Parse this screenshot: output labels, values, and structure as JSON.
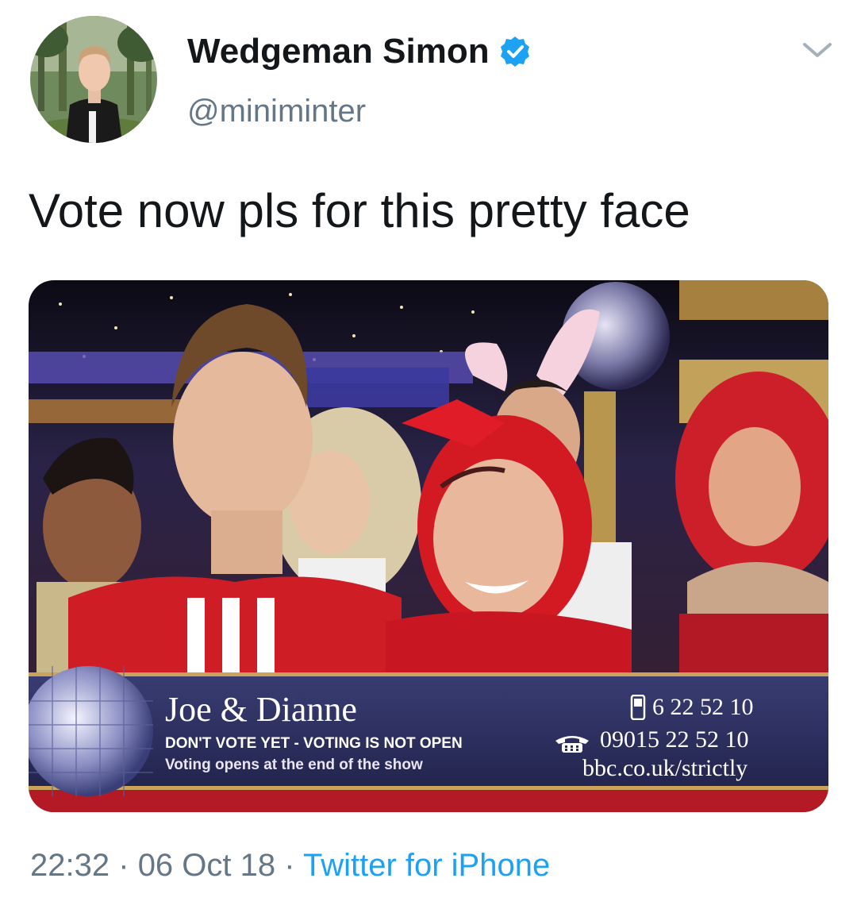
{
  "author": {
    "display_name": "Wedgeman Simon",
    "handle": "@miniminter",
    "verified": true,
    "avatar_icon": "profile-photo",
    "verified_icon": "verified-badge-icon"
  },
  "menu": {
    "icon": "chevron-down-icon"
  },
  "tweet": {
    "text": "Vote now pls for this pretty face"
  },
  "media": {
    "lower_third": {
      "couple": "Joe & Dianne",
      "warning": "DON'T VOTE YET - VOTING IS NOT OPEN",
      "opens": "Voting opens at the end of the show",
      "mobile_number": "6 22 52 10",
      "landline_number": "09015 22 52 10",
      "url": "bbc.co.uk/strictly"
    }
  },
  "meta": {
    "time": "22:32",
    "separator": "·",
    "date": "06 Oct 18",
    "source": "Twitter for iPhone"
  },
  "colors": {
    "text_primary": "#14171a",
    "text_secondary": "#657786",
    "link": "#1da1f2",
    "verified": "#1da1f2"
  }
}
